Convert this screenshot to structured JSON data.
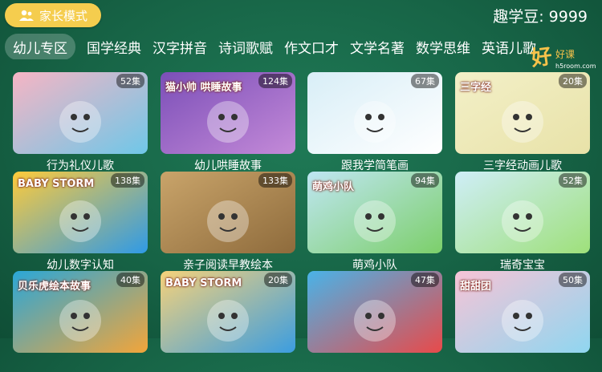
{
  "header": {
    "parent_mode_label": "家长模式",
    "beans_label": "趣学豆: 9999"
  },
  "tabs": [
    {
      "label": "幼儿专区",
      "active": true
    },
    {
      "label": "国学经典",
      "active": false
    },
    {
      "label": "汉字拼音",
      "active": false
    },
    {
      "label": "诗词歌赋",
      "active": false
    },
    {
      "label": "作文口才",
      "active": false
    },
    {
      "label": "文学名著",
      "active": false
    },
    {
      "label": "数学思维",
      "active": false
    },
    {
      "label": "英语儿歌",
      "active": false
    }
  ],
  "logo": {
    "text": "好",
    "sub": "好课",
    "site": "h5room.com"
  },
  "cards": [
    {
      "title": "行为礼仪儿歌",
      "count": "52集",
      "colors": [
        "#f6b5c4",
        "#6fc7e8"
      ],
      "overlay": "",
      "icon": "kids-cartoon-icon"
    },
    {
      "title": "幼儿哄睡故事",
      "count": "124集",
      "colors": [
        "#7b4fb8",
        "#c48ad8"
      ],
      "overlay": "猫小帅 哄睡故事",
      "icon": "cat-cartoon-icon"
    },
    {
      "title": "跟我学简笔画",
      "count": "67集",
      "colors": [
        "#d8eef7",
        "#ffffff"
      ],
      "overlay": "",
      "icon": "shark-drawing-icon"
    },
    {
      "title": "三字经动画儿歌",
      "count": "20集",
      "colors": [
        "#f3f0c8",
        "#e8e2a8"
      ],
      "overlay": "三字经",
      "icon": "tiger-cartoon-icon"
    },
    {
      "title": "幼儿数字认知",
      "count": "138集",
      "colors": [
        "#ffcb3a",
        "#2f9ae6"
      ],
      "overlay": "BABY STORM",
      "icon": "babystorm-logo-icon"
    },
    {
      "title": "亲子阅读早教绘本",
      "count": "133集",
      "colors": [
        "#c9a46a",
        "#8e6b3c"
      ],
      "overlay": "",
      "icon": "rabbit-cartoon-icon"
    },
    {
      "title": "萌鸡小队",
      "count": "94集",
      "colors": [
        "#bfe6f3",
        "#7ccf6a"
      ],
      "overlay": "萌鸡小队",
      "icon": "chick-cartoon-icon"
    },
    {
      "title": "瑞奇宝宝",
      "count": "52集",
      "colors": [
        "#cfeef8",
        "#9ee07a"
      ],
      "overlay": "",
      "icon": "bunny-cartoon-icon"
    },
    {
      "title": "",
      "count": "40集",
      "colors": [
        "#2aa7d8",
        "#f2a53a"
      ],
      "overlay": "贝乐虎绘本故事",
      "icon": "tiger-cartoon-icon"
    },
    {
      "title": "",
      "count": "20集",
      "colors": [
        "#f6d27a",
        "#3b9de0"
      ],
      "overlay": "BABY STORM",
      "icon": "babystorm-logo-icon"
    },
    {
      "title": "",
      "count": "47集",
      "colors": [
        "#49b3e8",
        "#e84a4a"
      ],
      "overlay": "",
      "icon": "numbers-monster-icon"
    },
    {
      "title": "",
      "count": "50集",
      "colors": [
        "#f7c4d6",
        "#8fd6f0"
      ],
      "overlay": "甜甜团",
      "icon": "dog-cartoon-icon"
    }
  ]
}
